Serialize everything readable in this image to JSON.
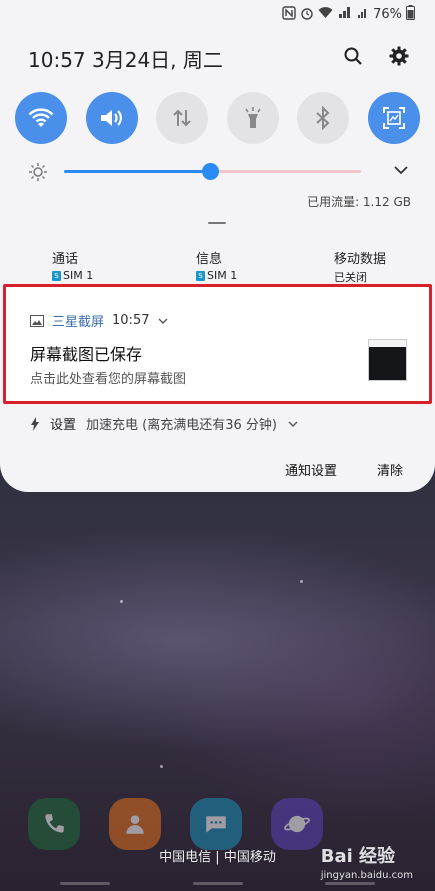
{
  "status_bar": {
    "icons": [
      "nfc-icon",
      "alarm-icon",
      "wifi-icon",
      "lte-signal-icon",
      "signal-icon"
    ],
    "battery": "76%"
  },
  "header": {
    "time_date": "10:57  3月24日, 周二",
    "search_icon": "search-icon",
    "settings_icon": "gear-icon"
  },
  "quick_settings": [
    {
      "name": "wifi",
      "state": "on"
    },
    {
      "name": "sound",
      "state": "on"
    },
    {
      "name": "mobile-data",
      "state": "off"
    },
    {
      "name": "flashlight",
      "state": "off"
    },
    {
      "name": "bluetooth",
      "state": "off"
    },
    {
      "name": "screenshot",
      "state": "on"
    }
  ],
  "brightness": {
    "level": 0.49
  },
  "data_usage": "已用流量: 1.12 GB",
  "sim_info": [
    {
      "label": "通话",
      "value": "SIM 1",
      "badge": "S"
    },
    {
      "label": "信息",
      "value": "SIM 1",
      "badge": "S"
    },
    {
      "label": "移动数据",
      "value": "已关闭"
    }
  ],
  "notification": {
    "app_name": "三星截屏",
    "time": "10:57",
    "title": "屏幕截图已保存",
    "subtitle": "点击此处查看您的屏幕截图"
  },
  "charging": {
    "app": "设置",
    "text": "加速充电 (离充满电还有36 分钟)"
  },
  "actions": {
    "notification_settings": "通知设置",
    "clear": "清除"
  },
  "carrier": "中国电信 | 中国移动",
  "watermark": {
    "brand": "Bai 经验",
    "site": "jingyan.baidu.com"
  },
  "colors": {
    "accent": "#4a8fea",
    "alert": "#d8202a"
  }
}
